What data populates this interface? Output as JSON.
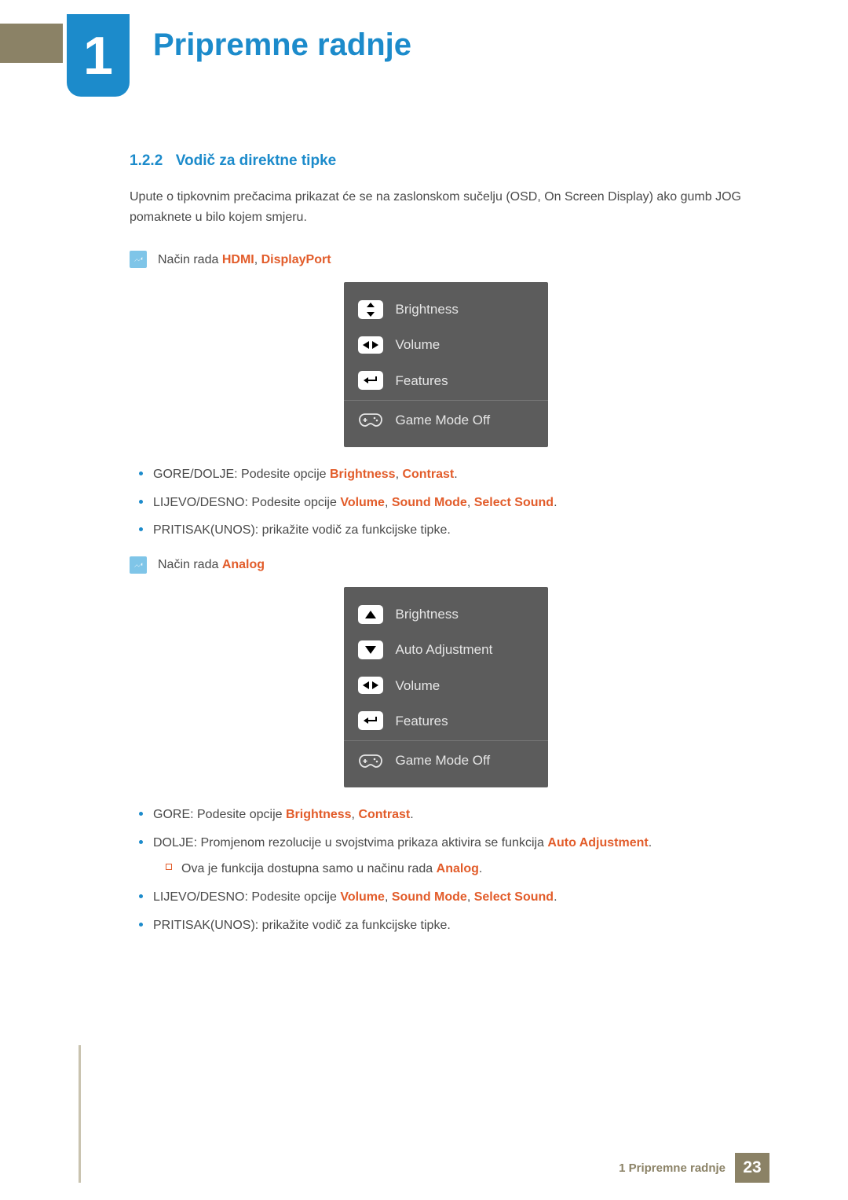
{
  "header": {
    "chapter_number": "1",
    "chapter_title": "Pripremne radnje"
  },
  "section": {
    "number": "1.2.2",
    "title": "Vodič za direktne tipke",
    "intro": "Upute o tipkovnim prečacima prikazat će se na zaslonskom sučelju (OSD, On Screen Display) ako gumb JOG pomaknete u bilo kojem smjeru."
  },
  "note1": {
    "prefix": "Način rada ",
    "hl1": "HDMI",
    "sep": ", ",
    "hl2": "DisplayPort"
  },
  "osd1": {
    "rows": [
      {
        "icon": "updown-icon",
        "label": "Brightness"
      },
      {
        "icon": "leftright-icon",
        "label": "Volume"
      },
      {
        "icon": "enter-icon",
        "label": "Features"
      },
      {
        "icon": "gamepad-icon",
        "label": "Game Mode Off"
      }
    ]
  },
  "list1": [
    {
      "prefix": "GORE/DOLJE: Podesite opcije ",
      "hl": [
        "Brightness",
        "Contrast"
      ],
      "seps": [
        ", ",
        "."
      ]
    },
    {
      "prefix": "LIJEVO/DESNO: Podesite opcije ",
      "hl": [
        "Volume",
        "Sound Mode",
        "Select Sound"
      ],
      "seps": [
        ", ",
        ", ",
        "."
      ]
    },
    {
      "prefix": "PRITISAK(UNOS): prikažite vodič za funkcijske tipke."
    }
  ],
  "note2": {
    "prefix": "Način rada ",
    "hl": "Analog"
  },
  "osd2": {
    "rows": [
      {
        "icon": "up-icon",
        "label": "Brightness"
      },
      {
        "icon": "down-icon",
        "label": "Auto Adjustment"
      },
      {
        "icon": "leftright-icon",
        "label": "Volume"
      },
      {
        "icon": "enter-icon",
        "label": "Features"
      },
      {
        "icon": "gamepad-icon",
        "label": "Game Mode Off"
      }
    ]
  },
  "list2": [
    {
      "prefix": "GORE: Podesite opcije ",
      "hl": [
        "Brightness",
        "Contrast"
      ],
      "seps": [
        ", ",
        "."
      ]
    },
    {
      "prefix": "DOLJE: Promjenom rezolucije u svojstvima prikaza aktivira se funkcija ",
      "hl": [
        "Auto Adjustment"
      ],
      "seps": [
        "."
      ],
      "sub": {
        "prefix": "Ova je funkcija dostupna samo u načinu rada ",
        "hl": "Analog",
        "suffix": "."
      }
    },
    {
      "prefix": "LIJEVO/DESNO: Podesite opcije ",
      "hl": [
        "Volume",
        "Sound Mode",
        "Select Sound"
      ],
      "seps": [
        ", ",
        ", ",
        "."
      ]
    },
    {
      "prefix": "PRITISAK(UNOS): prikažite vodič za funkcijske tipke."
    }
  ],
  "footer": {
    "text": "1 Pripremne radnje",
    "page": "23"
  }
}
